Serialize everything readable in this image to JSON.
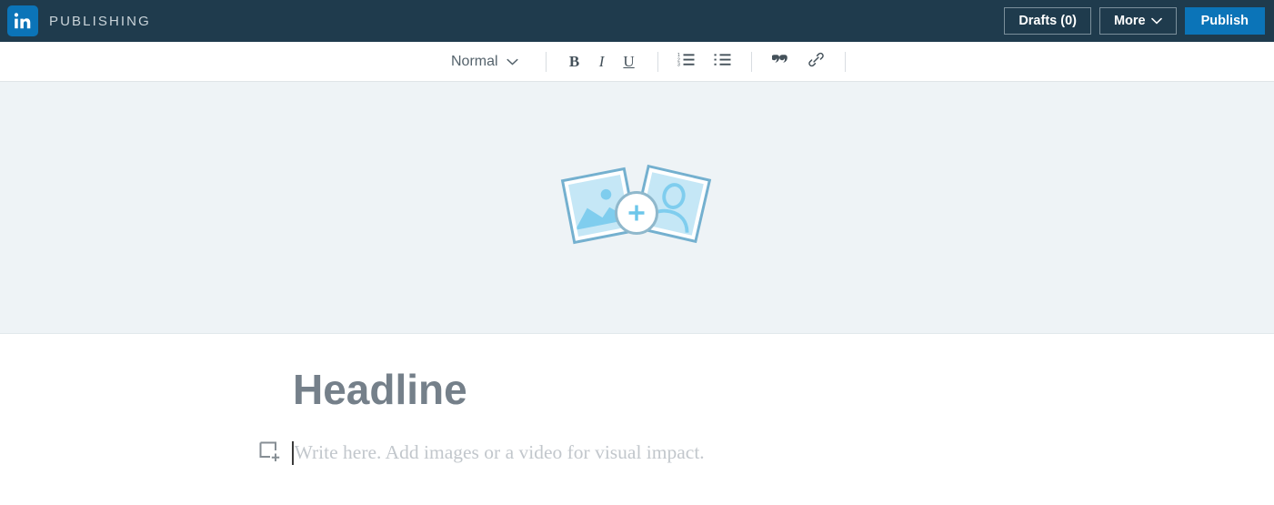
{
  "header": {
    "logo_icon": "linkedin-logo-icon",
    "brand_name": "PUBLISHING",
    "brand_color": "#0b74b8",
    "bar_color": "#1f3b4d",
    "drafts_label": "Drafts (0)",
    "more_label": "More",
    "more_caret_icon": "chevron-down-icon",
    "publish_label": "Publish"
  },
  "toolbar": {
    "paragraph_style": "Normal",
    "style_caret_icon": "chevron-down-icon",
    "bold_label": "B",
    "bold_icon": "bold-icon",
    "italic_label": "I",
    "italic_icon": "italic-icon",
    "underline_label": "U",
    "underline_icon": "underline-icon",
    "ordered_list_icon": "ordered-list-icon",
    "bulleted_list_icon": "bulleted-list-icon",
    "quote_icon": "quote-icon",
    "link_icon": "link-icon"
  },
  "hero": {
    "background_color": "#eef3f6",
    "art_icon": "add-cover-photos-icon",
    "left_card_icon": "landscape-photo-icon",
    "right_card_icon": "portrait-photo-icon",
    "badge_icon": "plus-circle-icon",
    "card_fill_color": "#c5e7f6",
    "card_stroke_color": "#74b0cf"
  },
  "editor": {
    "headline_placeholder": "Headline",
    "media_icon": "add-media-icon",
    "body_placeholder": "Write here. Add images or a video for visual impact."
  }
}
